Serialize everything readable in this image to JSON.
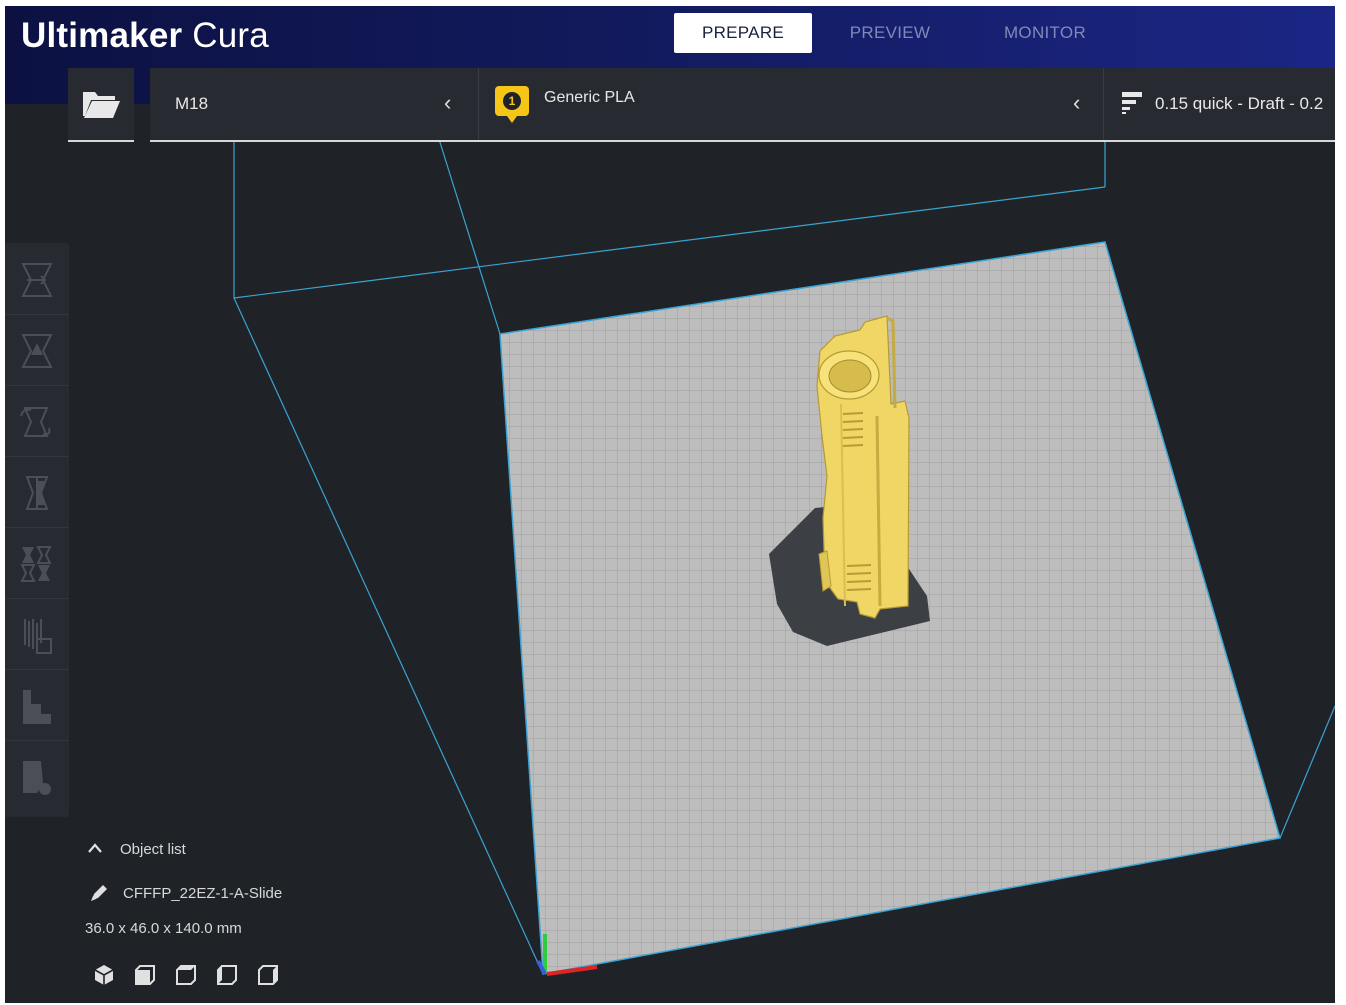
{
  "app": {
    "brand_bold": "Ultimaker",
    "brand_light": "Cura"
  },
  "stages": {
    "prepare": "PREPARE",
    "preview": "PREVIEW",
    "monitor": "MONITOR"
  },
  "header": {
    "printer": "M18",
    "extruder_index": "1",
    "material": "Generic PLA",
    "profile": "0.15 quick - Draft - 0.2"
  },
  "object_list": {
    "toggle_label": "Object list",
    "object_name": "CFFFP_22EZ-1-A-Slide",
    "dimensions": "36.0 x 46.0 x 140.0 mm"
  },
  "icons": {
    "open": "folder-open-icon",
    "tools": [
      "move-icon",
      "scale-icon",
      "rotate-icon",
      "mirror-icon",
      "per-model-settings-icon",
      "support-blocker-icon",
      "stairs-icon",
      "custom-support-icon"
    ],
    "views": [
      "view-3d-icon",
      "view-front-icon",
      "view-top-icon",
      "view-left-icon",
      "view-right-icon"
    ]
  },
  "colors": {
    "accent_tab_bg": "#ffffff",
    "material_badge": "#f5c518",
    "model_yellow": "#f0d665",
    "build_plate": "#b9b9b9",
    "volume_lines": "#3aa3d3"
  }
}
